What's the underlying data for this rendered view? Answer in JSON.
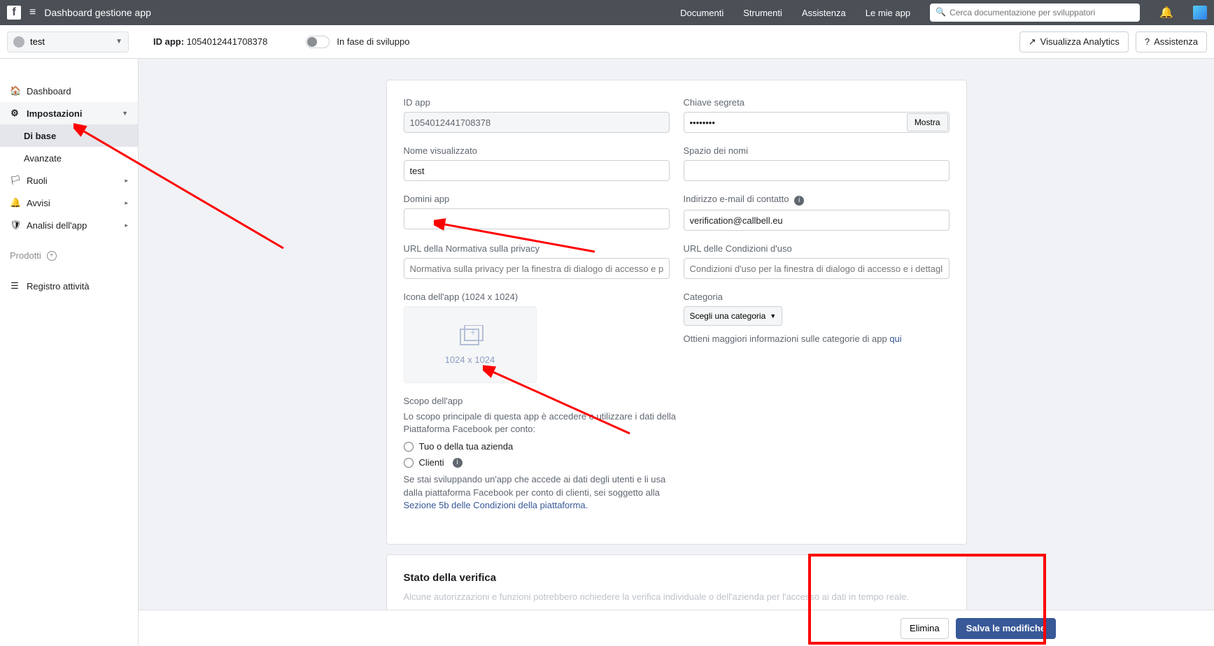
{
  "header": {
    "title": "Dashboard gestione app",
    "nav": [
      "Documenti",
      "Strumenti",
      "Assistenza",
      "Le mie app"
    ],
    "search_placeholder": "Cerca documentazione per sviluppatori"
  },
  "secbar": {
    "app_name": "test",
    "appid_label": "ID app:",
    "appid_value": "1054012441708378",
    "mode_label": "In fase di sviluppo",
    "analytics_btn": "Visualizza Analytics",
    "help_btn": "Assistenza"
  },
  "sidebar": {
    "items": [
      {
        "icon": "home",
        "label": "Dashboard",
        "expand": false
      },
      {
        "icon": "gear",
        "label": "Impostazioni",
        "expand": true,
        "children": [
          {
            "label": "Di base",
            "selected": true
          },
          {
            "label": "Avanzate",
            "selected": false
          }
        ]
      },
      {
        "icon": "flag",
        "label": "Ruoli",
        "expand": true
      },
      {
        "icon": "bell",
        "label": "Avvisi",
        "expand": true
      },
      {
        "icon": "shield",
        "label": "Analisi dell'app",
        "expand": true
      }
    ],
    "products_label": "Prodotti",
    "activity_label": "Registro attività"
  },
  "form": {
    "appid_label": "ID app",
    "appid_value": "1054012441708378",
    "secret_label": "Chiave segreta",
    "secret_value": "••••••••",
    "show_btn": "Mostra",
    "displayname_label": "Nome visualizzato",
    "displayname_value": "test",
    "namespace_label": "Spazio dei nomi",
    "namespace_value": "",
    "domains_label": "Domini app",
    "domains_value": "",
    "contact_label": "Indirizzo e-mail di contatto",
    "contact_value": "verification@callbell.eu",
    "privacy_label": "URL della Normativa sulla privacy",
    "privacy_placeholder": "Normativa sulla privacy per la finestra di dialogo di accesso e per i de",
    "tos_label": "URL delle Condizioni d'uso",
    "tos_placeholder": "Condizioni d'uso per la finestra di dialogo di accesso e i dettagli dell'a",
    "icon_label": "Icona dell'app (1024 x 1024)",
    "icon_hint": "1024 x 1024",
    "category_label": "Categoria",
    "category_select": "Scegli una categoria",
    "category_more": "Ottieni maggiori informazioni sulle categorie di app ",
    "category_link": "qui",
    "purpose_label": "Scopo dell'app",
    "purpose_desc": "Lo scopo principale di questa app è accedere e utilizzare i dati della Piattaforma Facebook per conto:",
    "purpose_opt1": "Tuo o della tua azienda",
    "purpose_opt2": "Clienti",
    "purpose_note": "Se stai sviluppando un'app che accede ai dati degli utenti e li usa dalla piattaforma Facebook per conto di clienti, sei soggetto alla ",
    "purpose_link": "Sezione 5b delle Condizioni della piattaforma."
  },
  "card2": {
    "title": "Stato della verifica",
    "desc": "Alcune autorizzazioni e funzioni potrebbero richiedere la verifica individuale o dell'azienda per l'accesso ai dati in tempo reale."
  },
  "footer": {
    "delete": "Elimina",
    "save": "Salva le modifiche"
  }
}
